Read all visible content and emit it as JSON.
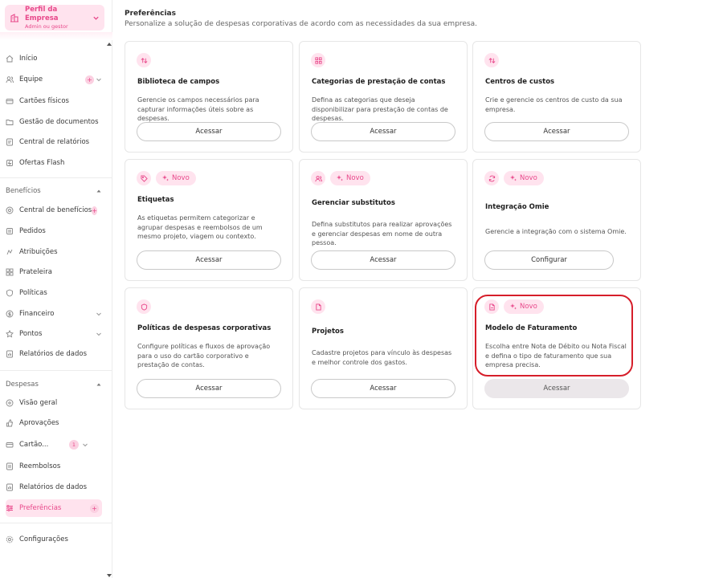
{
  "profile": {
    "name": "Perfil da Empresa",
    "role": "Admin ou gestor"
  },
  "sidebar": {
    "main_items": [
      {
        "label": "Início",
        "icon": "home-icon"
      },
      {
        "label": "Equipe",
        "icon": "users-icon"
      },
      {
        "label": "Cartões físicos",
        "icon": "card-icon"
      },
      {
        "label": "Gestão de documentos",
        "icon": "folder-icon"
      },
      {
        "label": "Central de relatórios",
        "icon": "report-icon"
      },
      {
        "label": "Ofertas Flash",
        "icon": "flash-icon"
      }
    ],
    "beneficios": {
      "title": "Benefícios",
      "items": [
        {
          "label": "Central de benefícios",
          "icon": "benefits-icon"
        },
        {
          "label": "Pedidos",
          "icon": "orders-icon"
        },
        {
          "label": "Atribuições",
          "icon": "assign-icon"
        },
        {
          "label": "Prateleira",
          "icon": "shelf-icon"
        },
        {
          "label": "Políticas",
          "icon": "policy-icon"
        },
        {
          "label": "Financeiro",
          "icon": "finance-icon"
        },
        {
          "label": "Pontos",
          "icon": "points-icon"
        },
        {
          "label": "Relatórios de dados",
          "icon": "data-report-icon"
        }
      ]
    },
    "despesas": {
      "title": "Despesas",
      "items": [
        {
          "label": "Visão geral",
          "icon": "overview-icon"
        },
        {
          "label": "Aprovações",
          "icon": "approval-icon"
        },
        {
          "label": "Cartão...",
          "icon": "card-icon",
          "badge": "1"
        },
        {
          "label": "Reembolsos",
          "icon": "refund-icon"
        },
        {
          "label": "Relatórios de dados",
          "icon": "data-report-icon"
        },
        {
          "label": "Preferências",
          "icon": "preferences-icon"
        }
      ]
    },
    "config": {
      "label": "Configurações",
      "icon": "settings-icon"
    }
  },
  "page": {
    "title": "Preferências",
    "subtitle": "Personalize a solução de despesas corporativas de acordo com as necessidades da sua empresa."
  },
  "new_badge": "Novo",
  "cards": [
    {
      "title": "Biblioteca de campos",
      "description": "Gerencie os campos necessários para capturar informações úteis sobre as despesas.",
      "button": "Acessar",
      "icon": "fields-icon"
    },
    {
      "title": "Categorias de prestação de contas",
      "description": "Defina as categorias que deseja disponibilizar para prestação de contas de despesas.",
      "button": "Acessar",
      "icon": "categories-icon"
    },
    {
      "title": "Centros de custos",
      "description": "Crie e gerencie os centros de custo da sua empresa.",
      "button": "Acessar",
      "icon": "cost-center-icon"
    },
    {
      "title": "Etiquetas",
      "description": "As etiquetas permitem categorizar e agrupar despesas e reembolsos de um mesmo projeto, viagem ou contexto.",
      "button": "Acessar",
      "icon": "tag-icon",
      "is_new": true
    },
    {
      "title": "Gerenciar substitutos",
      "description": "Defina substitutos para realizar aprovações e gerenciar despesas em nome de outra pessoa.",
      "button": "Acessar",
      "icon": "substitutes-icon",
      "is_new": true
    },
    {
      "title": "Integração Omie",
      "description": "Gerencie a integração com o sistema Omie.",
      "button": "Configurar",
      "icon": "sync-icon",
      "is_new": true
    },
    {
      "title": "Políticas de despesas corporativas",
      "description": "Configure políticas e fluxos de aprovação para o uso do cartão corporativo e prestação de contas.",
      "button": "Acessar",
      "icon": "shield-icon"
    },
    {
      "title": "Projetos",
      "description": "Cadastre projetos para vínculo às despesas e melhor controle dos gastos.",
      "button": "Acessar",
      "icon": "document-icon"
    },
    {
      "title": "Modelo de Faturamento",
      "description": "Escolha entre Nota de Débito ou Nota Fiscal e defina o tipo de faturamento que sua empresa precisa.",
      "button": "Acessar",
      "icon": "invoice-icon",
      "is_new": true
    }
  ],
  "colors": {
    "accent": "#e8488a",
    "accent_bg": "#ffe3ee",
    "highlight": "#d61e2a"
  }
}
